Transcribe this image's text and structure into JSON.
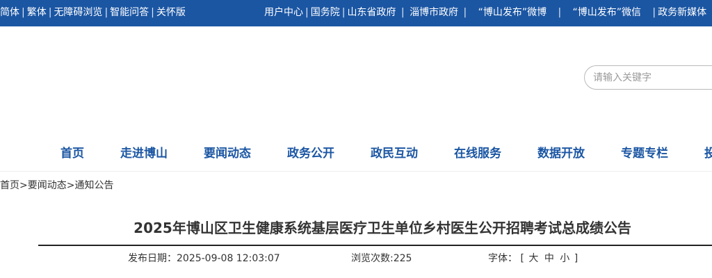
{
  "topbar": {
    "left_links": [
      "简体",
      "繁体",
      "无障碍浏览",
      "智能问答",
      "关怀版"
    ],
    "right_links": [
      "用户中心",
      "国务院",
      "山东省政府",
      "淄博市政府",
      "“博山发布”微博",
      "“博山发布”微信",
      "政务新媒体"
    ]
  },
  "search": {
    "placeholder": "请输入关键字"
  },
  "nav": {
    "items": [
      "首页",
      "走进博山",
      "要闻动态",
      "政务公开",
      "政民互动",
      "在线服务",
      "数据开放",
      "专题专栏",
      "投"
    ]
  },
  "breadcrumb": {
    "home": "首页",
    "sep": ">",
    "section": "要闻动态",
    "current": "通知公告"
  },
  "article": {
    "title": "2025年博山区卫生健康系统基层医疗卫生单位乡村医生公开招聘考试总成绩公告",
    "publish_label": "发布日期：",
    "publish_date": "2025-09-08 12:03:07",
    "views_label": "浏览次数:",
    "views": "225",
    "font_label": "字体：",
    "font_open": "[",
    "font_large": "大",
    "font_medium": "中",
    "font_small": "小",
    "font_close": "]"
  },
  "colors": {
    "brand": "#1b56a3",
    "topbar_bg": "#1b56a3"
  }
}
